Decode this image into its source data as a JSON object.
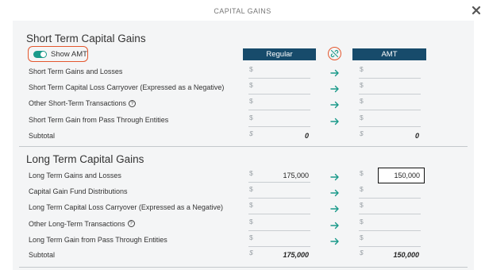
{
  "modal": {
    "title": "CAPITAL GAINS"
  },
  "toggle": {
    "label": "Show AMT",
    "on": true
  },
  "columns": {
    "regular": "Regular",
    "amt": "AMT"
  },
  "icons": {
    "close": "close-icon",
    "link": "broken-link-icon",
    "arrow": "arrow-right-icon"
  },
  "colors": {
    "header_bg": "#174b6b",
    "accent": "#1a9a8a",
    "highlight": "#e4572e"
  },
  "short_term": {
    "title": "Short Term Capital Gains",
    "rows": [
      {
        "label": "Short Term Gains and Losses",
        "help": false,
        "regular": "",
        "amt": ""
      },
      {
        "label": "Short Term Capital Loss Carryover (Expressed as a Negative)",
        "help": false,
        "regular": "",
        "amt": ""
      },
      {
        "label": "Other Short-Term Transactions",
        "help": true,
        "regular": "",
        "amt": ""
      },
      {
        "label": "Short Term Gain from Pass Through Entities",
        "help": false,
        "regular": "",
        "amt": ""
      }
    ],
    "subtotal": {
      "label": "Subtotal",
      "regular": "0",
      "amt": "0"
    }
  },
  "long_term": {
    "title": "Long Term Capital Gains",
    "rows": [
      {
        "label": "Long Term Gains and Losses",
        "help": false,
        "regular": "175,000",
        "amt": "150,000"
      },
      {
        "label": "Capital Gain Fund Distributions",
        "help": false,
        "regular": "",
        "amt": ""
      },
      {
        "label": "Long Term Capital Loss Carryover (Expressed as a Negative)",
        "help": false,
        "regular": "",
        "amt": ""
      },
      {
        "label": "Other Long-Term Transactions",
        "help": true,
        "regular": "",
        "amt": ""
      },
      {
        "label": "Long Term Gain from Pass Through Entities",
        "help": false,
        "regular": "",
        "amt": ""
      }
    ],
    "subtotal": {
      "label": "Subtotal",
      "regular": "175,000",
      "amt": "150,000"
    }
  },
  "currency_symbol": "$",
  "help_symbol": "?"
}
